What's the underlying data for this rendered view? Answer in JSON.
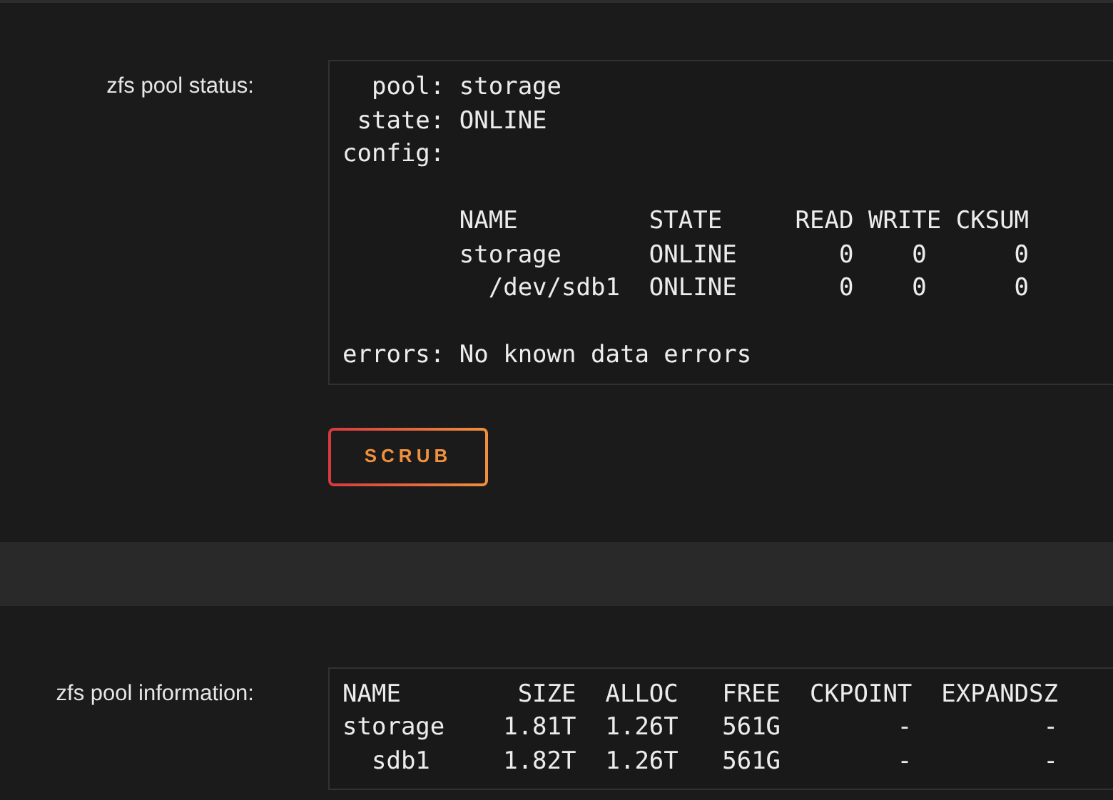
{
  "sections": [
    {
      "label": "zfs pool status:",
      "output_groups": [
        [
          "  pool: storage",
          " state: ONLINE",
          "config:"
        ],
        [
          "        NAME         STATE     READ WRITE CKSUM",
          "        storage      ONLINE       0    0      0",
          "          /dev/sdb1  ONLINE       0    0      0"
        ],
        [
          "errors: No known data errors"
        ]
      ],
      "button": "SCRUB"
    },
    {
      "label": "zfs pool information:",
      "output_groups": [
        [
          "NAME        SIZE  ALLOC   FREE  CKPOINT  EXPANDSZ",
          "storage    1.81T  1.26T   561G        -         -",
          "  sdb1     1.82T  1.26T   561G        -         -"
        ]
      ]
    }
  ]
}
